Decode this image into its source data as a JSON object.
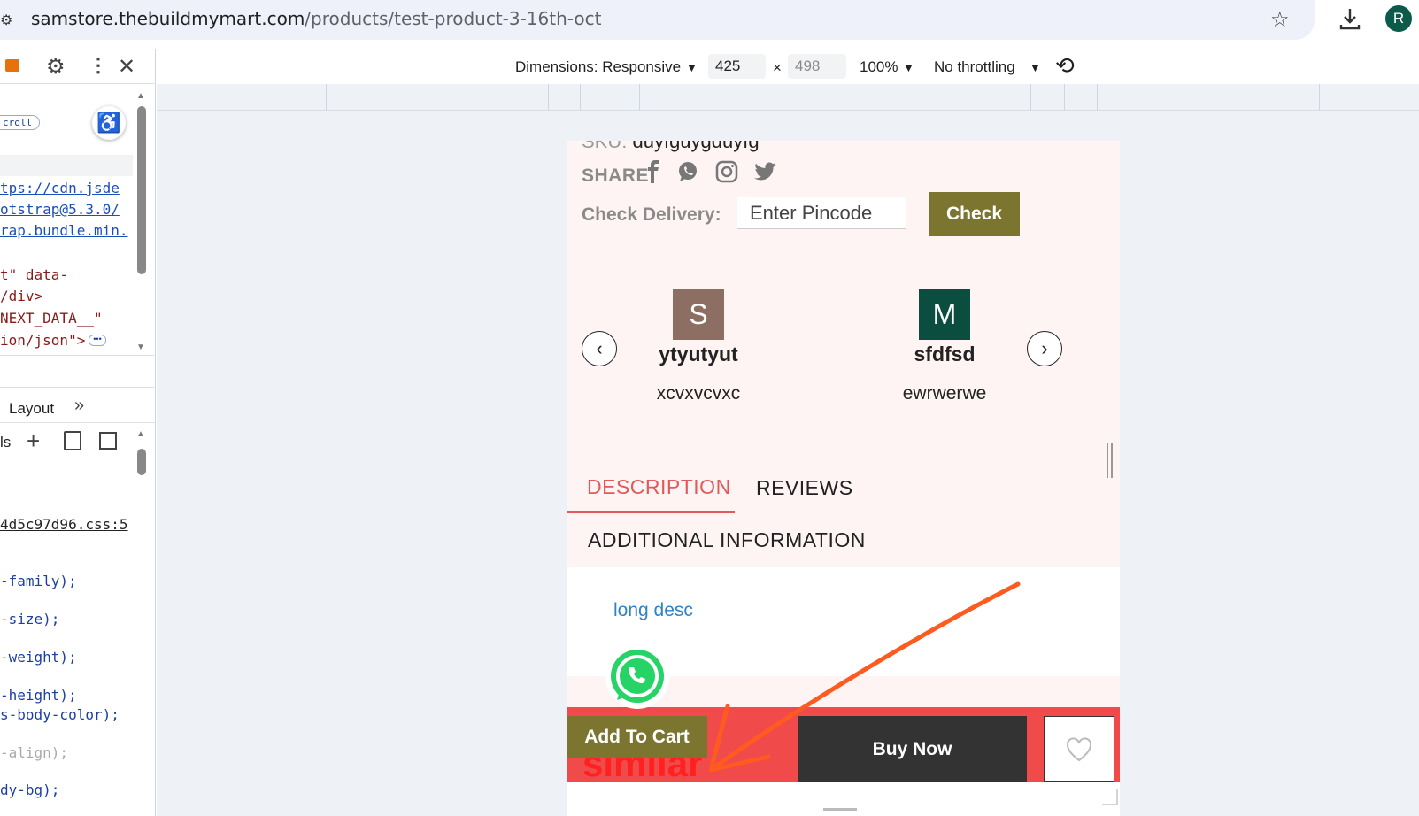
{
  "browser": {
    "url_host": "samstore.thebuildmymart.com",
    "url_path": "/products/test-product-3-16th-oct",
    "profile_initial": "R"
  },
  "devtools": {
    "scroll_badge": "croll",
    "code_lines": [
      "tps://cdn.jsde",
      "otstrap@5.3.0/",
      "rap.bundle.min.",
      "t\" data-",
      "/div>",
      "NEXT_DATA__\"",
      "ion/json\">"
    ],
    "layout_tab": "Layout",
    "styles_label": "ls",
    "css_file": "4d5c97d96.css:5",
    "css_lines": [
      "-family);",
      "-size);",
      "-weight);",
      "-height);",
      "s-body-color);",
      "-align);",
      "dy-bg);"
    ]
  },
  "device_toolbar": {
    "dimensions_label": "Dimensions: Responsive",
    "width": "425",
    "times": "×",
    "height": "498",
    "zoom": "100%",
    "throttle": "No throttling"
  },
  "product": {
    "sku_label": "SKU:",
    "sku_value": "duyfguygduyfg",
    "share_label": "SHARE:",
    "delivery_label": "Check Delivery:",
    "pincode_placeholder": "Enter Pincode",
    "check_button": "Check",
    "reviews": [
      {
        "initial": "S",
        "name": "ytyutyut",
        "text": "xcvxvcvxc",
        "color": "#8d6e63"
      },
      {
        "initial": "M",
        "name": "sfdfsd",
        "text": "ewrwerwe",
        "color": "#0b4d3e"
      }
    ],
    "tabs": {
      "description": "DESCRIPTION",
      "reviews": "REVIEWS",
      "additional": "ADDITIONAL INFORMATION"
    },
    "long_desc": "long desc",
    "similar_text": "similar",
    "add_to_cart": "Add To Cart",
    "buy_now": "Buy Now"
  },
  "colors": {
    "accent_olive": "#7b7530",
    "bar_red": "#f04a4a",
    "annotation_orange": "#ff5a1f"
  }
}
